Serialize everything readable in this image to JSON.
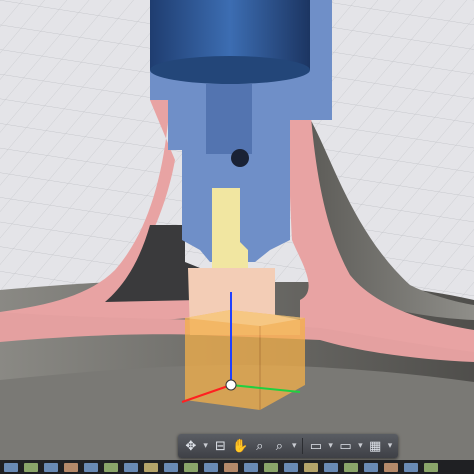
{
  "app": {
    "view": "3D section view"
  },
  "nav_toolbar": {
    "items": [
      {
        "icon": "orbit-icon",
        "glyph": "✥"
      },
      {
        "icon": "dropdown-caret-icon",
        "glyph": "▾"
      },
      {
        "icon": "look-at-icon",
        "glyph": "⊟"
      },
      {
        "icon": "pan-hand-icon",
        "glyph": "✋"
      },
      {
        "icon": "zoom-icon",
        "glyph": "⌕"
      },
      {
        "icon": "zoom-window-icon",
        "glyph": "⌕"
      },
      {
        "icon": "dropdown-caret-icon",
        "glyph": "▾"
      },
      {
        "icon": "display-settings-icon",
        "glyph": "▭"
      },
      {
        "icon": "dropdown-caret-icon",
        "glyph": "▾"
      },
      {
        "icon": "visual-style-icon",
        "glyph": "▭"
      },
      {
        "icon": "dropdown-caret-icon",
        "glyph": "▾"
      },
      {
        "icon": "viewports-icon",
        "glyph": "▦"
      },
      {
        "icon": "dropdown-caret-icon",
        "glyph": "▾"
      }
    ]
  },
  "colors": {
    "grid_bg": "#e4e4e8",
    "grid_line": "#c4c5ca",
    "body_section_pink": "#e8a3a3",
    "insert_section_blue": "#6f8fc8",
    "pin_yellow": "#f1e6a1",
    "slider_peach": "#f3cdb6",
    "surface_gray": "#6b6a66",
    "selection_orange": "#f4b04a",
    "axis_blue": "#2040ff",
    "axis_red": "#ff2020",
    "axis_green": "#20d040"
  }
}
